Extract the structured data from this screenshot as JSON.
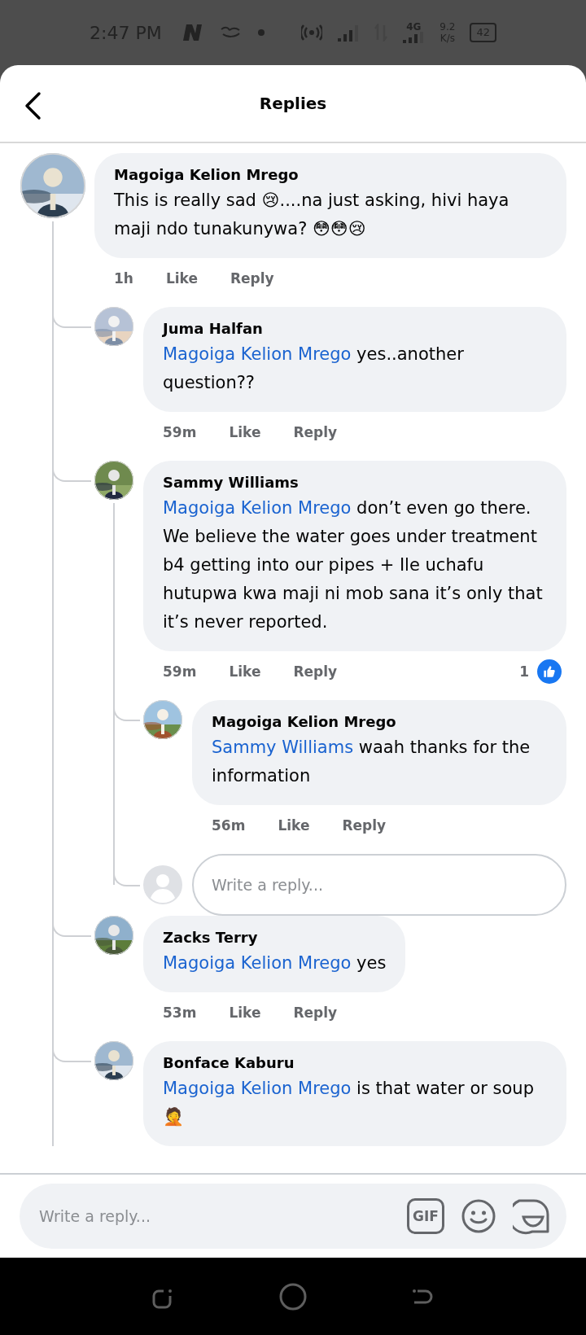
{
  "status_bar": {
    "time": "2:47 PM",
    "network": "4G",
    "speed": "9.2",
    "speed_unit": "K/s",
    "battery": "42"
  },
  "header": {
    "title": "Replies"
  },
  "comment": {
    "author": "Magoiga Kelion Mrego",
    "text": "This is really sad 😢....na just asking, hivi haya maji ndo tunakunywa? 😳😳😢",
    "time": "1h",
    "like": "Like",
    "reply": "Reply",
    "replies": [
      {
        "author": "Juma Halfan",
        "mention": "Magoiga Kelion Mrego",
        "text": "yes..another question??",
        "time": "59m",
        "like": "Like",
        "reply": "Reply"
      },
      {
        "author": "Sammy Williams",
        "mention": "Magoiga Kelion Mrego",
        "text": "don’t even go there. We believe the water goes under treatment b4 getting into our pipes + Ile uchafu hutupwa kwa maji ni mob sana it’s only that it’s never reported.",
        "time": "59m",
        "like": "Like",
        "reply": "Reply",
        "reaction_count": "1",
        "replies": [
          {
            "author": "Magoiga Kelion Mrego",
            "mention": "Sammy Williams",
            "text": "waah thanks for the information",
            "time": "56m",
            "like": "Like",
            "reply": "Reply"
          }
        ],
        "reply_field": {
          "placeholder": "Write a reply..."
        }
      },
      {
        "author": "Zacks Terry",
        "mention": "Magoiga Kelion Mrego",
        "text": "yes",
        "time": "53m",
        "like": "Like",
        "reply": "Reply"
      },
      {
        "author": "Bonface Kaburu",
        "mention": "Magoiga Kelion Mrego",
        "text": "is that water or soup 🤦"
      }
    ]
  },
  "composer": {
    "placeholder": "Write a reply...",
    "gif": "GIF"
  }
}
